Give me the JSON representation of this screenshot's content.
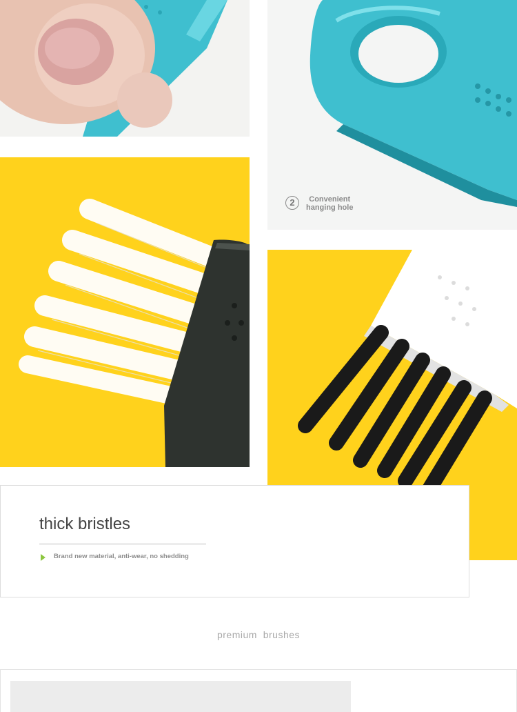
{
  "features": {
    "hanging_hole": {
      "number": "2",
      "line1": "Convenient",
      "line2": "hanging hole"
    },
    "bristles": {
      "title": "thick bristles",
      "description": "Brand new material, anti-wear, no shedding"
    }
  },
  "section_heading": "premium  brushes",
  "colors": {
    "brush_teal": "#3fbfcf",
    "background_yellow": "#ffd21c",
    "handle_black": "#2e332f",
    "accent_green": "#8cc63f"
  }
}
